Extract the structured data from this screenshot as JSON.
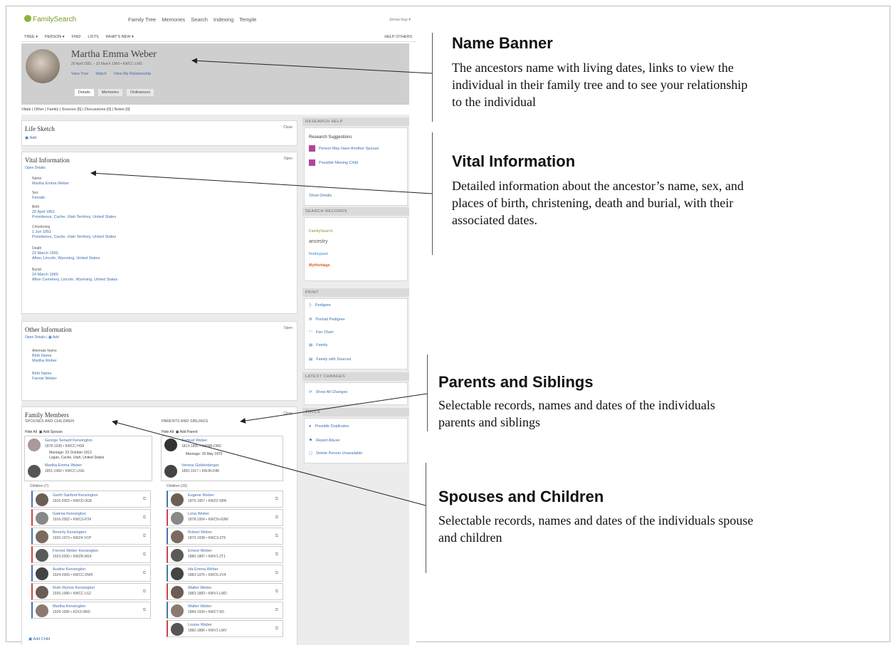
{
  "app": {
    "logo": "FamilySearch",
    "nav": [
      "Family Tree",
      "Memories",
      "Search",
      "Indexing",
      "Temple"
    ],
    "signin": "Jenna Kay ▾"
  },
  "toolbar": [
    "TREE ▾",
    "PERSON ▾",
    "FIND",
    "LISTS",
    "WHAT'S NEW ▾"
  ],
  "toolbar_help": "HELP OTHERS",
  "banner": {
    "name": "Martha Emma Weber",
    "dates": "20 April 1851 – 23 March 1960 • KWCC-LNG",
    "links": [
      "View Tree",
      "Watch",
      "View My Relationship"
    ],
    "tabs": [
      "Details",
      "Memories",
      "Ordinances"
    ]
  },
  "subnav": "Vitals | Other | Family | Sources [5] | Discussions [0] | Notes [0]",
  "life_sketch": {
    "title": "Life Sketch",
    "action": "Close",
    "add": "Add"
  },
  "vital": {
    "title": "Vital Information",
    "action": "Open",
    "open_details": "Open Details",
    "items": [
      {
        "label": "Name",
        "value": "Martha Emma Weber"
      },
      {
        "label": "Sex",
        "value": "Female"
      },
      {
        "label": "Birth",
        "value": "20 April 1851",
        "place": "Providence, Cache, Utah Territory, United States"
      },
      {
        "label": "Christening",
        "value": "1 Jun 1851",
        "place": "Providence, Cache, Utah Territory, United States"
      },
      {
        "label": "Death",
        "value": "23 March 1960",
        "place": "Afton, Lincoln, Wyoming, United States"
      },
      {
        "label": "Burial",
        "value": "24 March 1960",
        "place": "Afton Cemetery, Lincoln, Wyoming, United States"
      }
    ]
  },
  "other": {
    "title": "Other Information",
    "action": "Open",
    "open_details": "Open Details",
    "add": "Add",
    "items": [
      {
        "label": "Alternate Name",
        "value1": "Birth Name",
        "value2": "Martha Weber"
      },
      {
        "label": "",
        "value1": "Birth Name",
        "value2": "Fannie Weber"
      }
    ]
  },
  "family": {
    "title": "Family Members",
    "action": "Close",
    "spouses_header": "SPOUSES AND CHILDREN",
    "parents_header": "PARENTS AND SIBLINGS",
    "hide_all": "Hide All",
    "add_spouse": "Add Spouse",
    "add_parent": "Add Parent",
    "add_child": "Add Child",
    "spouse": {
      "name": "George Senard Kensington",
      "dates": "1878-1938 • KWCC-HS8",
      "marriage": "Marriage: 23 October 1913",
      "marriage_place": "Logan, Cache, Utah, United States"
    },
    "self": {
      "name": "Martha Emma Weber",
      "dates": "1851-1960 • KWCC-LNG"
    },
    "children_label": "Children (7)",
    "children": [
      {
        "name": "Garth Sanford Kensington",
        "dates": "1915-2002 • KWCD-3G8"
      },
      {
        "name": "Galena Kensington",
        "dates": "1916-2002 • KWCS-P24"
      },
      {
        "name": "Beverly Kensington",
        "dates": "1920-1973 • KWZ4-VCP"
      },
      {
        "name": "Forrest Weber Kensington",
        "dates": "1923-2000 • KWZR-M19"
      },
      {
        "name": "Audine Kensington",
        "dates": "1924-2009 • KWCC-DW5"
      },
      {
        "name": "Ruth Wynne Kensington",
        "dates": "1926-1980 • KWCC-L6Z"
      },
      {
        "name": "Martha Kensington",
        "dates": "1928-1996 • K2X3-W60"
      }
    ],
    "father": {
      "name": "Samuel Weber",
      "dates": "1813-1895 • KWNB-DMC"
    },
    "parent_marriage": "Marriage: 18 May 1870",
    "mother": {
      "name": "Verena Goldenberger",
      "dates": "1850-1917 • KWJN-F88"
    },
    "siblings_label": "Children (10)",
    "siblings": [
      {
        "name": "Eugene Weber",
        "dates": "1876-1957 • KWZ2-SBN"
      },
      {
        "name": "Lena Weber",
        "dates": "1878-1954 • KWCN-G9W"
      },
      {
        "name": "Robert Weber",
        "dates": "1879-1938 • KWC3-2T6"
      },
      {
        "name": "Ernest Weber",
        "dates": "1880-1887 • KWV1-2T1"
      },
      {
        "name": "Ida Emma Weber",
        "dates": "1883-1975 • KWC6-2V4"
      },
      {
        "name": "Walter Weber",
        "dates": "1883-1883 • KWV1-LMD"
      },
      {
        "name": "Walter Weber",
        "dates": "1884-1934 • KWC7-9D"
      },
      {
        "name": "Louise Weber",
        "dates": "1882-1886 • KWV1-LMV"
      }
    ]
  },
  "research_help": {
    "header": "RESEARCH HELP",
    "title": "Research Suggestions",
    "items": [
      "Person May Have Another Spouse",
      "Possible Missing Child"
    ],
    "show": "Show Details"
  },
  "search_records": {
    "header": "SEARCH RECORDS",
    "items": [
      "FamilySearch",
      "ancestry",
      "findmypast",
      "MyHeritage"
    ]
  },
  "print": {
    "header": "PRINT",
    "items": [
      "Pedigree",
      "Portrait Pedigree",
      "Fan Chart",
      "Family",
      "Family with Sources"
    ]
  },
  "latest": {
    "header": "LATEST CHANGES",
    "item": "Show All Changes"
  },
  "tools": {
    "header": "TOOLS",
    "items": [
      "Possible Duplicates",
      "Report Abuse",
      "Delete Person Unavailable"
    ]
  },
  "annotations": [
    {
      "title": "Name Banner",
      "body": [
        "The ancestors name with living dates, links to view the",
        "individual in their family tree and to see your relationship",
        "to the individual"
      ]
    },
    {
      "title": "Vital Information",
      "body": [
        "Detailed information about the ancestor’s name, sex, and",
        "places of birth, christening, death and burial, with their",
        "associated dates."
      ]
    },
    {
      "title": "Parents and Siblings",
      "body": [
        "Selectable records, names and dates of the individuals",
        "parents and siblings"
      ]
    },
    {
      "title": "Spouses and Children",
      "body": [
        "Selectable records, names and dates of the individuals spouse",
        "and children"
      ]
    }
  ],
  "colors": {
    "link": "#3a6fb0",
    "banner": "#cfcfcf",
    "logo": "#7a9b2a"
  }
}
